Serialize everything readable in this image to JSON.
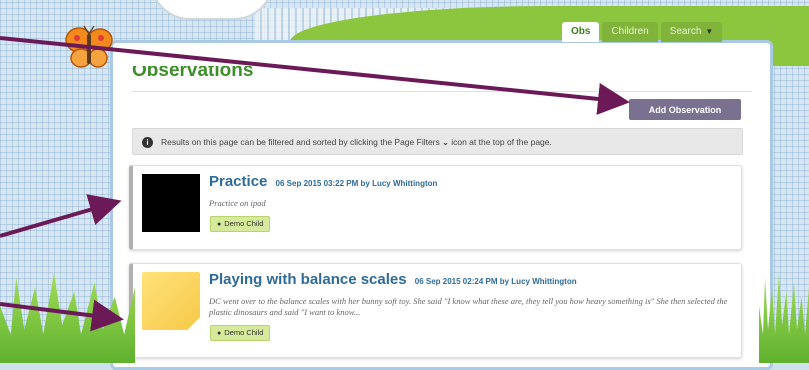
{
  "nav": {
    "tabs": [
      {
        "label": "Obs"
      },
      {
        "label": "Children"
      },
      {
        "label": "Search"
      }
    ]
  },
  "page": {
    "title": "Observations",
    "add_button": "Add Observation",
    "info_text_pre": "Results on this page can be filtered and sorted by clicking the Page Filters",
    "info_text_post": "icon at the top of the page."
  },
  "observations": [
    {
      "title": "Practice",
      "date": "06 Sep 2015 03:22 PM",
      "by": "by",
      "author": "Lucy Whittington",
      "description": "Practice on ipad",
      "tag": "Demo Child"
    },
    {
      "title": "Playing with balance scales",
      "date": "06 Sep 2015 02:24 PM",
      "by": "by",
      "author": "Lucy Whittington",
      "description": "DC went over to the balance scales with her bunny soft toy. She said \"I know what these are, they tell you how heavy something is\" She then selected the plastic dinosaurs and said \"I want to know...",
      "tag": "Demo Child"
    }
  ],
  "colors": {
    "title_green": "#3e8f2b",
    "link_blue": "#2e6b9a",
    "button": "#7a7090",
    "tag": "#d6ea9b",
    "arrow": "#6b1a57"
  }
}
